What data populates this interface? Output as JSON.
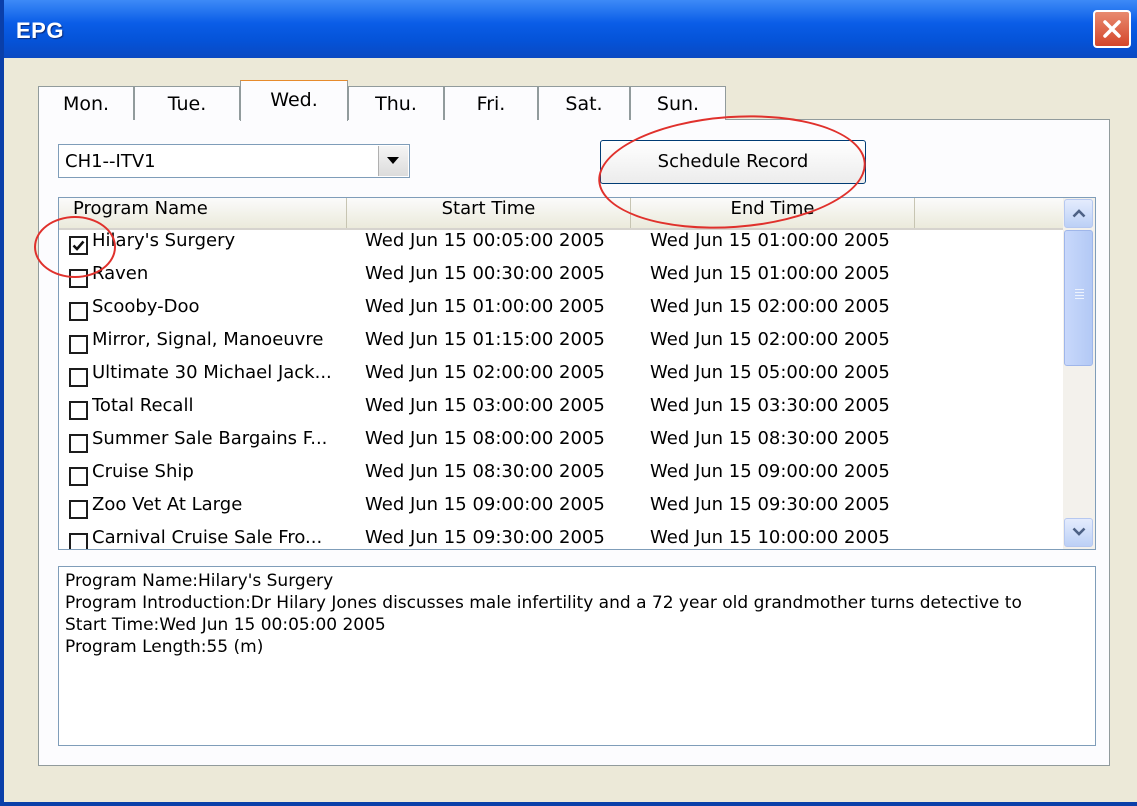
{
  "window": {
    "title": "EPG",
    "close_icon": "close-icon"
  },
  "tabs": [
    {
      "label": "Mon."
    },
    {
      "label": "Tue."
    },
    {
      "label": "Wed.",
      "selected": true
    },
    {
      "label": "Thu."
    },
    {
      "label": "Fri."
    },
    {
      "label": "Sat."
    },
    {
      "label": "Sun."
    }
  ],
  "channel_select": {
    "value": "CH1--ITV1",
    "arrow_icon": "chevron-down-icon"
  },
  "schedule_button": {
    "label": "Schedule Record"
  },
  "program_list": {
    "columns": [
      "Program Name",
      "Start Time",
      "End Time"
    ],
    "rows": [
      {
        "name": "Hilary's Surgery",
        "start": "Wed Jun 15 00:05:00 2005",
        "end": "Wed Jun 15 01:00:00 2005",
        "checked": true
      },
      {
        "name": "Raven",
        "start": "Wed Jun 15 00:30:00 2005",
        "end": "Wed Jun 15 01:00:00 2005",
        "checked": false
      },
      {
        "name": "Scooby-Doo",
        "start": "Wed Jun 15 01:00:00 2005",
        "end": "Wed Jun 15 02:00:00 2005",
        "checked": false
      },
      {
        "name": "Mirror, Signal, Manoeuvre",
        "start": "Wed Jun 15 01:15:00 2005",
        "end": "Wed Jun 15 02:00:00 2005",
        "checked": false
      },
      {
        "name": "Ultimate 30 Michael Jack...",
        "start": "Wed Jun 15 02:00:00 2005",
        "end": "Wed Jun 15 05:00:00 2005",
        "checked": false
      },
      {
        "name": "Total Recall",
        "start": "Wed Jun 15 03:00:00 2005",
        "end": "Wed Jun 15 03:30:00 2005",
        "checked": false
      },
      {
        "name": "Summer Sale Bargains F...",
        "start": "Wed Jun 15 08:00:00 2005",
        "end": "Wed Jun 15 08:30:00 2005",
        "checked": false
      },
      {
        "name": "Cruise Ship",
        "start": "Wed Jun 15 08:30:00 2005",
        "end": "Wed Jun 15 09:00:00 2005",
        "checked": false
      },
      {
        "name": "Zoo Vet At Large",
        "start": "Wed Jun 15 09:00:00 2005",
        "end": "Wed Jun 15 09:30:00 2005",
        "checked": false
      },
      {
        "name": "Carnival Cruise Sale Fro...",
        "start": "Wed Jun 15 09:30:00 2005",
        "end": "Wed Jun 15 10:00:00 2005",
        "checked": false
      }
    ]
  },
  "details": {
    "lines": [
      "Program Name:Hilary's Surgery",
      "Program Introduction:Dr Hilary Jones discusses male infertility and a 72 year old grandmother turns detective to",
      "Start Time:Wed Jun 15 00:05:00 2005",
      "Program Length:55 (m)"
    ]
  },
  "colors": {
    "annotation": "#e0312c",
    "titlebar": "#0a5de7",
    "window_bg": "#ece9d8"
  }
}
